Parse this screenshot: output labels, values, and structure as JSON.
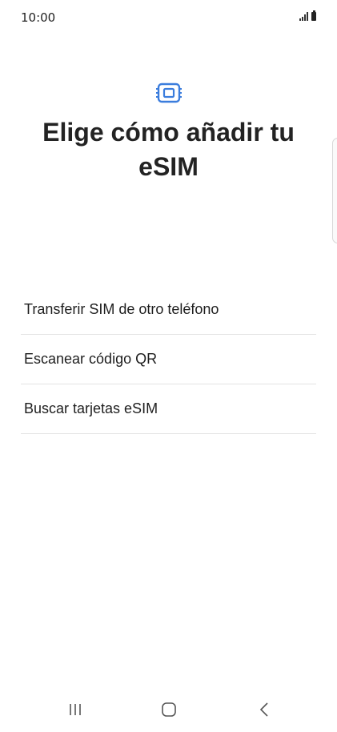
{
  "status_bar": {
    "time": "10:00"
  },
  "header": {
    "icon": "esim-card-icon",
    "title": "Elige cómo añadir tu eSIM"
  },
  "options": [
    {
      "label": "Transferir SIM de otro teléfono"
    },
    {
      "label": "Escanear código QR"
    },
    {
      "label": "Buscar tarjetas eSIM"
    }
  ],
  "nav_bar": {
    "recents": "recents-icon",
    "home": "home-icon",
    "back": "back-icon"
  },
  "colors": {
    "accent": "#3b7ddd",
    "text": "#232323",
    "divider": "#e3e3e3"
  }
}
